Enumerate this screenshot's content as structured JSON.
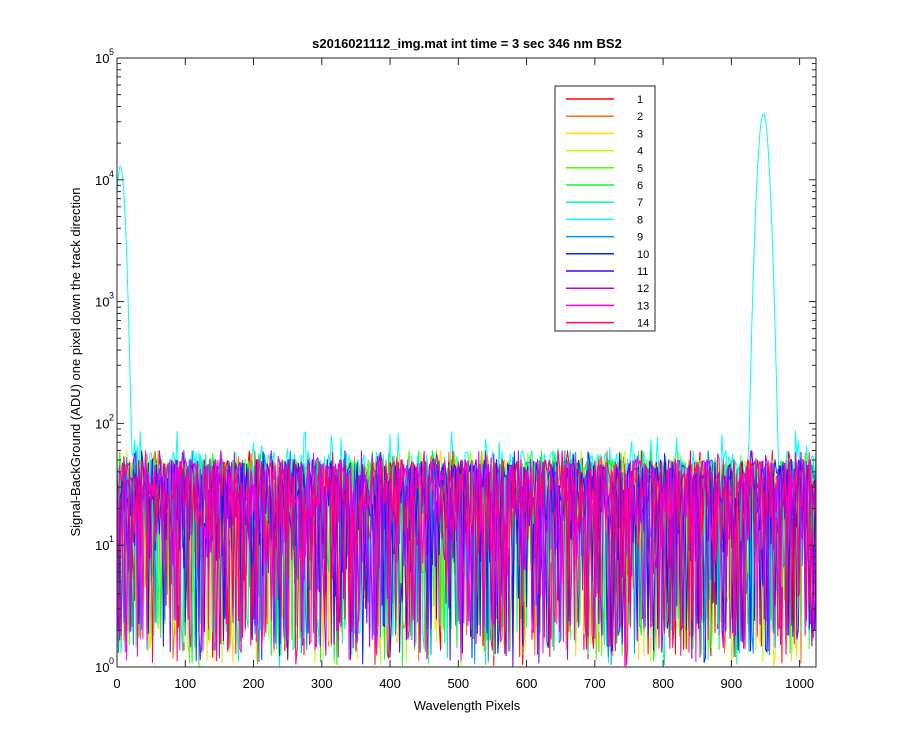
{
  "chart_data": {
    "type": "line",
    "title": "s2016021112_img.mat int time = 3 sec  346 nm BS2",
    "xlabel": "Wavelength Pixels",
    "ylabel": "Signal-BackGround (ADU) one pixel down the track direction",
    "xlim": [
      0,
      1024
    ],
    "ylim": [
      1,
      100000
    ],
    "yscale": "log",
    "x_ticks": [
      "0",
      "100",
      "200",
      "300",
      "400",
      "500",
      "600",
      "700",
      "800",
      "900",
      "1000"
    ],
    "y_ticks": [
      {
        "base": "10",
        "exp": "0"
      },
      {
        "base": "10",
        "exp": "1"
      },
      {
        "base": "10",
        "exp": "2"
      },
      {
        "base": "10",
        "exp": "3"
      },
      {
        "base": "10",
        "exp": "4"
      },
      {
        "base": "10",
        "exp": "5"
      }
    ],
    "grid": false,
    "legend_position": "top-right",
    "series_note_noise_range": [
      1,
      60
    ],
    "series": [
      {
        "name": "1",
        "color": "#ff0000"
      },
      {
        "name": "2",
        "color": "#ff6d00"
      },
      {
        "name": "3",
        "color": "#ffdb00"
      },
      {
        "name": "4",
        "color": "#b6ff00"
      },
      {
        "name": "5",
        "color": "#49ff00"
      },
      {
        "name": "6",
        "color": "#00ff24"
      },
      {
        "name": "7",
        "color": "#00ff92"
      },
      {
        "name": "8",
        "color": "#00ffff",
        "peaks": [
          {
            "x": 5,
            "y": 13000
          },
          {
            "x": 947,
            "y": 35000
          }
        ],
        "baseline": [
          40,
          60
        ]
      },
      {
        "name": "9",
        "color": "#0092ff"
      },
      {
        "name": "10",
        "color": "#0024ff"
      },
      {
        "name": "11",
        "color": "#4900ff"
      },
      {
        "name": "12",
        "color": "#b600ff"
      },
      {
        "name": "13",
        "color": "#ff00db"
      },
      {
        "name": "14",
        "color": "#ff006d"
      }
    ]
  }
}
